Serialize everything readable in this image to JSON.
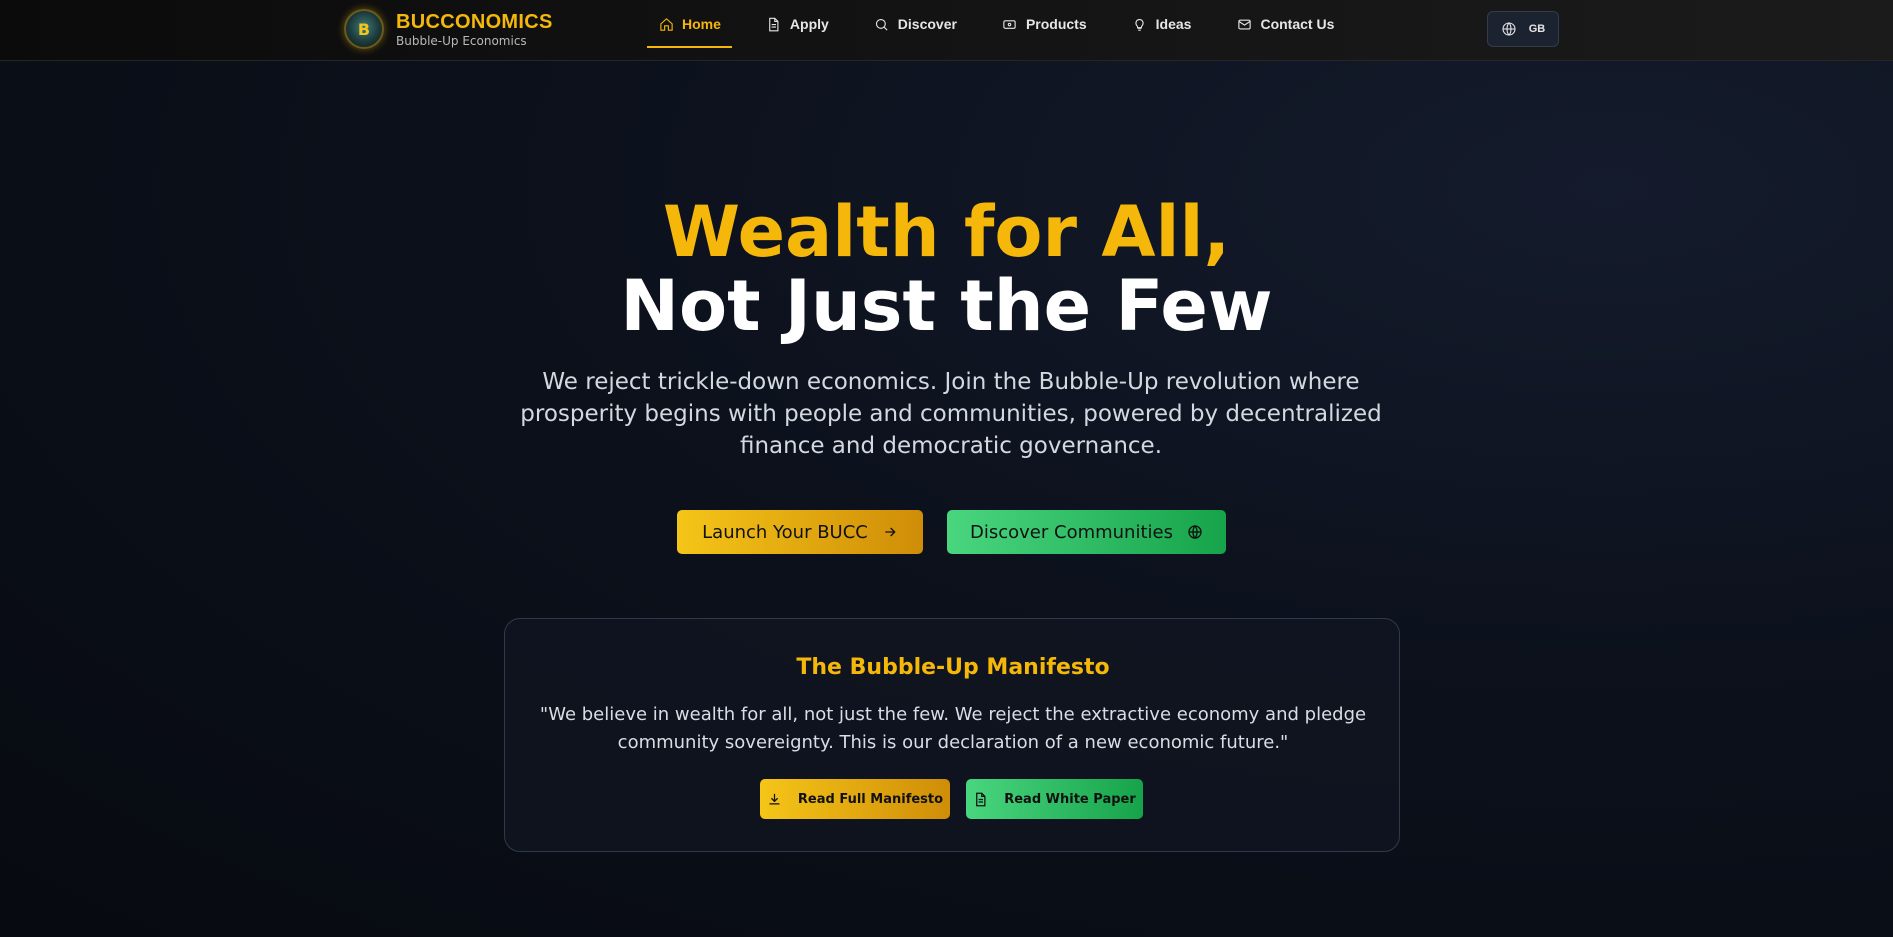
{
  "brand": {
    "title": "BUCCONOMICS",
    "subtitle": "Bubble-Up Economics",
    "logo_glyph": "B"
  },
  "nav": {
    "items": [
      {
        "label": "Home",
        "icon": "home-icon",
        "active": true
      },
      {
        "label": "Apply",
        "icon": "document-icon"
      },
      {
        "label": "Discover",
        "icon": "search-icon"
      },
      {
        "label": "Products",
        "icon": "ticket-icon"
      },
      {
        "label": "Ideas",
        "icon": "lightbulb-icon"
      },
      {
        "label": "Contact Us",
        "icon": "mail-icon"
      }
    ],
    "language": {
      "code": "GB",
      "icon": "globe-icon"
    }
  },
  "hero": {
    "headline_line1": "Wealth for All,",
    "headline_line2": "Not Just the Few",
    "lead": "We reject trickle-down economics. Join the Bubble-Up revolution where prosperity begins with people and communities, powered by decentralized finance and democratic governance.",
    "primary_button": "Launch Your BUCC",
    "secondary_button": "Discover Communities"
  },
  "manifesto": {
    "title": "The Bubble-Up Manifesto",
    "quote": "\"We believe in wealth for all, not just the few. We reject the extractive economy and pledge community sovereignty. This is our declaration of a new economic future.\"",
    "read_manifesto_button": "Read Full Manifesto",
    "read_whitepaper_button": "Read White Paper"
  },
  "colors": {
    "accent_gold": "#f5b70a",
    "accent_green": "#22c55e",
    "background": "#0c111c"
  }
}
